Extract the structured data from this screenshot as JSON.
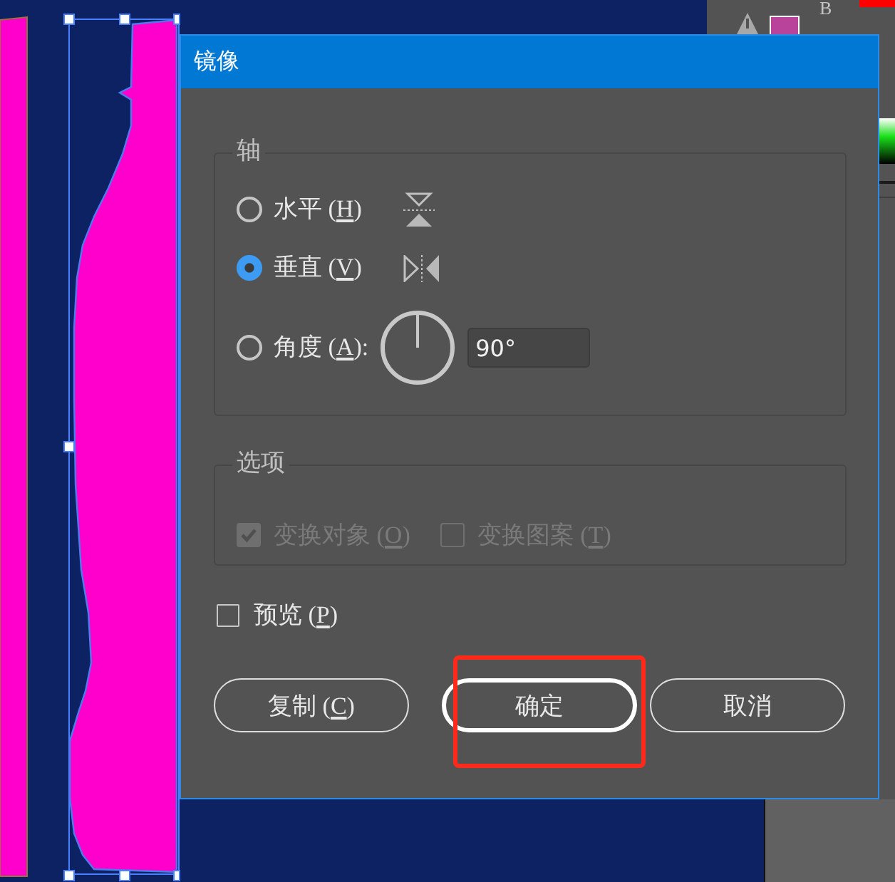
{
  "side_panel": {
    "label": "B"
  },
  "dialog": {
    "title": "镜像",
    "axis": {
      "title": "轴",
      "options": [
        {
          "kind": "horizontal",
          "label": "水平",
          "access_key": "(H)",
          "selected": false
        },
        {
          "kind": "vertical",
          "label": "垂直",
          "access_key": "(V)",
          "selected": true
        },
        {
          "kind": "angle",
          "label": "角度",
          "access_key": "(A):",
          "selected": false,
          "value": "90°"
        }
      ]
    },
    "options": {
      "title": "选项",
      "disabled": true,
      "items": [
        {
          "label": "变换对象",
          "access_key": "(O)",
          "checked": true
        },
        {
          "label": "变换图案",
          "access_key": "(T)",
          "checked": false
        }
      ]
    },
    "preview": {
      "label": "预览",
      "access_key": "(P)",
      "checked": false
    },
    "buttons": [
      {
        "label": "复制",
        "access_key": "(C)",
        "default": false,
        "highlighted": false
      },
      {
        "label": "确定",
        "default": true,
        "highlighted": true
      },
      {
        "label": "取消",
        "default": false,
        "highlighted": false
      }
    ]
  }
}
